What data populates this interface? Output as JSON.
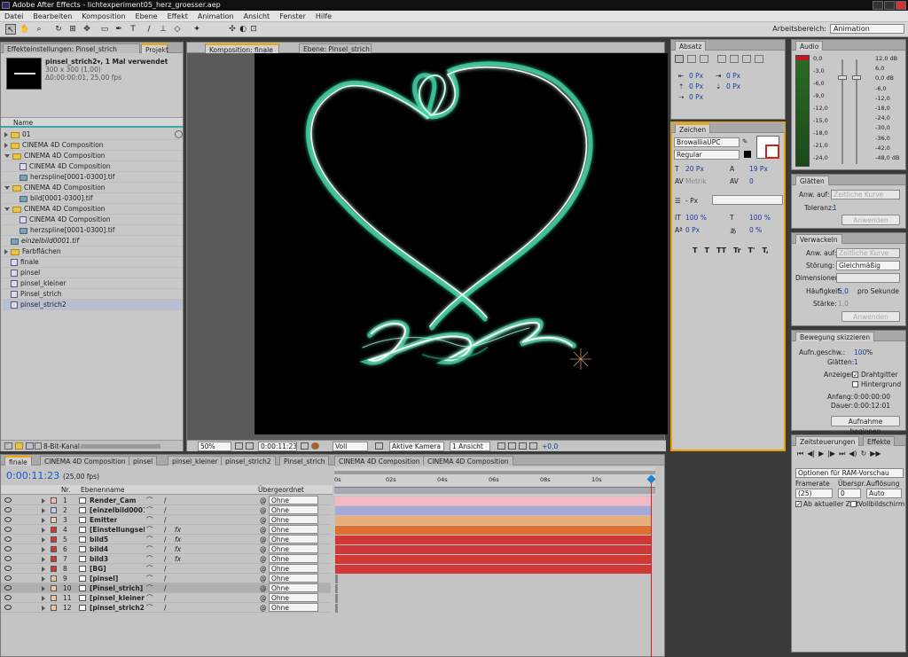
{
  "window": {
    "title": "Adobe After Effects - lichtexperiment05_herz_groesser.aep"
  },
  "menu": [
    "Datei",
    "Bearbeiten",
    "Komposition",
    "Ebene",
    "Effekt",
    "Animation",
    "Ansicht",
    "Fenster",
    "Hilfe"
  ],
  "toolbar": {
    "workspace_label": "Arbeitsbereich:",
    "workspace_value": "Animation"
  },
  "project": {
    "tabs": [
      "Effekteinstellungen: Pinsel_strich",
      "Projekt"
    ],
    "item_name": "pinsel_strich2▾, 1 Mal verwendet",
    "item_size": "300 x 300 (1,00)",
    "item_duration": "Δ0:00:00:01, 25,00 fps",
    "column_name": "Name",
    "rows": [
      {
        "name": "01",
        "type": "folder",
        "indent": 0
      },
      {
        "name": "CINEMA 4D Composition",
        "type": "folder",
        "indent": 0
      },
      {
        "name": "CINEMA 4D Composition",
        "type": "folder-open",
        "indent": 0
      },
      {
        "name": "CINEMA 4D Composition",
        "type": "comp",
        "indent": 1
      },
      {
        "name": "herzspline[0001-0300].tif",
        "type": "img",
        "indent": 1
      },
      {
        "name": "CINEMA 4D Composition",
        "type": "folder-open",
        "indent": 0
      },
      {
        "name": "bild[0001-0300].tif",
        "type": "img",
        "indent": 1
      },
      {
        "name": "CINEMA 4D Composition",
        "type": "folder-open",
        "indent": 0
      },
      {
        "name": "CINEMA 4D Composition",
        "type": "comp",
        "indent": 1
      },
      {
        "name": "herzspline[0001-0300].tif",
        "type": "img",
        "indent": 1
      },
      {
        "name": "einzelbild0001.tif",
        "type": "img",
        "indent": 0
      },
      {
        "name": "Farbflächen",
        "type": "folder",
        "indent": 0
      },
      {
        "name": "finale",
        "type": "comp",
        "indent": 0
      },
      {
        "name": "pinsel",
        "type": "comp",
        "indent": 0
      },
      {
        "name": "pinsel_kleiner",
        "type": "comp",
        "indent": 0
      },
      {
        "name": "Pinsel_strich",
        "type": "comp",
        "indent": 0
      },
      {
        "name": "pinsel_strich2",
        "type": "comp",
        "indent": 0
      }
    ],
    "bit_depth": "8-Bit-Kanal"
  },
  "comp_viewer": {
    "tabs": [
      "Komposition: finale",
      "Ebene: Pinsel_strich"
    ],
    "zoom": "50%",
    "timecode": "0:00:11:23",
    "resolution": "Voll",
    "camera": "Aktive Kamera",
    "views": "1 Ansicht",
    "exposure": "+0,0"
  },
  "absatz": {
    "tab": "Absatz",
    "fields": [
      {
        "label": "0 Px"
      },
      {
        "label": "0 Px"
      },
      {
        "label": "0 Px"
      },
      {
        "label": "0 Px"
      },
      {
        "label": "0 Px"
      }
    ]
  },
  "zeichen": {
    "tab": "Zeichen",
    "font": "BrowalliaUPC",
    "style": "Regular",
    "size": "20 Px",
    "leading": "19 Px",
    "kerning": "Metrik",
    "tracking": "0",
    "stroke": "- Px",
    "vscale": "100 %",
    "hscale": "100 %",
    "baseline": "0 Px",
    "tsume": "0 %",
    "styles": [
      "T",
      "T",
      "TT",
      "Tr",
      "T'",
      "T,"
    ]
  },
  "audio": {
    "tab": "Audio",
    "left_scale": [
      "0,0",
      "-3,0",
      "-6,0",
      "-9,0",
      "-12,0",
      "-15,0",
      "-18,0",
      "-21,0",
      "-24,0"
    ],
    "right_scale": [
      "12,0 dB",
      "6,0",
      "0,0 dB",
      "-6,0",
      "-12,0",
      "-18,0",
      "-24,0",
      "-30,0",
      "-36,0",
      "-42,0",
      "-48,0 dB"
    ]
  },
  "glaetten": {
    "tab": "Glätten",
    "anw_label": "Anw. auf:",
    "anw_value": "Zeitliche Kurve",
    "toleranz_label": "Toleranz:",
    "toleranz_value": "1",
    "apply": "Anwenden"
  },
  "verwackeln": {
    "tab": "Verwackeln",
    "anw_label": "Anw. auf:",
    "anw_value": "Zeitliche Kurve",
    "stoerung_label": "Störung:",
    "stoerung_value": "Gleichmäßig",
    "dim_label": "Dimensionen:",
    "freq_label": "Häufigkeit:",
    "freq_value": "5,0",
    "freq_unit": "pro Sekunde",
    "staerke_label": "Stärke:",
    "staerke_value": "1,0",
    "apply": "Anwenden"
  },
  "bewegung": {
    "tab": "Bewegung skizzieren",
    "speed_label": "Aufn.geschw.:",
    "speed_value": "100",
    "speed_unit": "%",
    "glaetten_label": "Glätten:",
    "glaetten_value": "1",
    "anzeigen_label": "Anzeigen:",
    "drahtgitter": "Drahtgitter",
    "hintergrund": "Hintergrund",
    "anfang_label": "Anfang:",
    "anfang_value": "0:00:00:00",
    "dauer_label": "Dauer:",
    "dauer_value": "0:00:12:01",
    "start_btn": "Aufnahme beginnen"
  },
  "zeitsteuerung": {
    "tabs": [
      "Zeitsteuerungen",
      "Effekte"
    ],
    "ram_option": "Optionen für RAM-Vorschau",
    "framerate_label": "Framerate",
    "skip_label": "Überspr.",
    "res_label": "Auflösung",
    "framerate_value": "(25)",
    "skip_value": "0",
    "res_value": "Auto",
    "from_current": "Ab aktueller Zeit",
    "fullscreen": "Vollbildschirm"
  },
  "timeline": {
    "tabs": [
      "finale",
      "CINEMA 4D Composition",
      "pinsel",
      "pinsel_kleiner",
      "pinsel_strich2",
      "Pinsel_strich",
      "CINEMA 4D Composition",
      "CINEMA 4D Composition"
    ],
    "timecode": "0:00:11:23",
    "fps": "(25,00 fps)",
    "col_nr": "Nr.",
    "col_name": "Ebenenname",
    "col_parent": "Übergeordnet",
    "ruler": [
      "0s",
      "02s",
      "04s",
      "06s",
      "08s",
      "10s"
    ],
    "layers": [
      {
        "nr": "1",
        "name": "Render_Cam",
        "color": "#f2b8c4",
        "parent": "Ohne",
        "bar": "#f2b8c4",
        "bar_start": 0.0,
        "bar_end": 1.0,
        "fx": false
      },
      {
        "nr": "2",
        "name": "[einzelbild0001.",
        "color": "#c8c8e8",
        "parent": "Ohne",
        "bar": "#a8a8d8",
        "bar_start": 0.0,
        "bar_end": 1.0,
        "fx": false
      },
      {
        "nr": "3",
        "name": "Emitter",
        "color": "#f0d0a0",
        "parent": "Ohne",
        "bar": "#e8b078",
        "bar_start": 0.0,
        "bar_end": 1.0,
        "fx": false
      },
      {
        "nr": "4",
        "name": "[Einstellungseb",
        "color": "#d03838",
        "parent": "Ohne",
        "bar": "#e07030",
        "bar_start": 0.0,
        "bar_end": 1.0,
        "fx": true
      },
      {
        "nr": "5",
        "name": "bild5",
        "color": "#d03838",
        "parent": "Ohne",
        "bar": "#d03838",
        "bar_start": 0.0,
        "bar_end": 1.0,
        "fx": true
      },
      {
        "nr": "6",
        "name": "bild4",
        "color": "#d03838",
        "parent": "Ohne",
        "bar": "#d03838",
        "bar_start": 0.0,
        "bar_end": 1.0,
        "fx": true
      },
      {
        "nr": "7",
        "name": "bild3",
        "color": "#d03838",
        "parent": "Ohne",
        "bar": "#d03838",
        "bar_start": 0.0,
        "bar_end": 1.0,
        "fx": true
      },
      {
        "nr": "8",
        "name": "[BG]",
        "color": "#d03838",
        "parent": "Ohne",
        "bar": "#d03838",
        "bar_start": 0.0,
        "bar_end": 1.0,
        "fx": false
      },
      {
        "nr": "9",
        "name": "[pinsel]",
        "color": "#e8c8a0",
        "parent": "Ohne",
        "bar": null,
        "bar_start": 0,
        "bar_end": 0,
        "fx": false
      },
      {
        "nr": "10",
        "name": "[Pinsel_strich]",
        "color": "#e8c8a0",
        "parent": "Ohne",
        "bar": null,
        "bar_start": 0,
        "bar_end": 0,
        "fx": false
      },
      {
        "nr": "11",
        "name": "[pinsel_kleiner]",
        "color": "#e8c8a0",
        "parent": "Ohne",
        "bar": null,
        "bar_start": 0,
        "bar_end": 0,
        "fx": false
      },
      {
        "nr": "12",
        "name": "[pinsel_strich2]",
        "color": "#e8c8a0",
        "parent": "Ohne",
        "bar": null,
        "bar_start": 0,
        "bar_end": 0,
        "fx": false
      }
    ]
  }
}
